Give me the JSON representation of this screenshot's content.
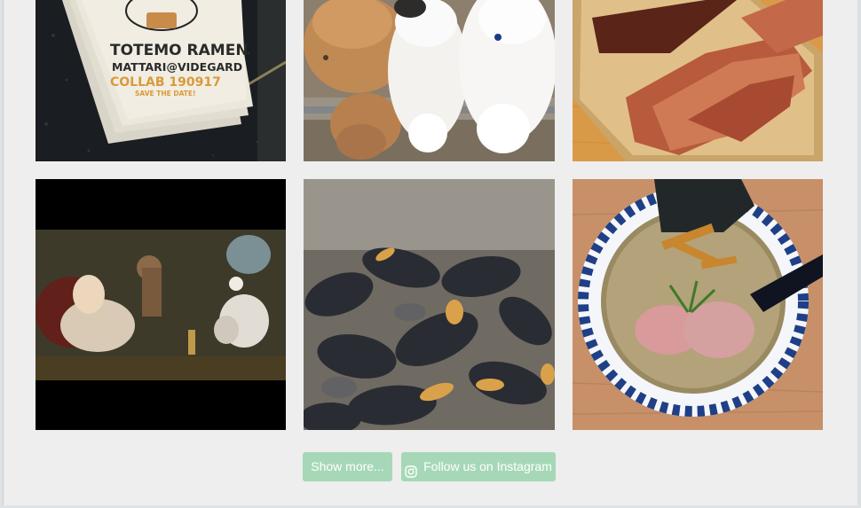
{
  "feed": {
    "tiles": [
      {
        "name": "ramen-card",
        "card_title": "TOTEMO RAMEN",
        "card_line1": "MATTARI@VIDEGARD",
        "card_line2": "COLLAB 190917",
        "card_line3": "SAVE THE DATE!"
      },
      {
        "name": "cats"
      },
      {
        "name": "katsuobushi"
      },
      {
        "name": "painting"
      },
      {
        "name": "mussels"
      },
      {
        "name": "ramen-bowl"
      }
    ]
  },
  "actions": {
    "show_more_label": "Show more...",
    "follow_label": "Follow us on Instagram",
    "follow_icon": "instagram-icon"
  },
  "colors": {
    "button_bg": "#a6d8b8",
    "button_text": "#ffffff",
    "page_bg": "#eeeeee"
  }
}
